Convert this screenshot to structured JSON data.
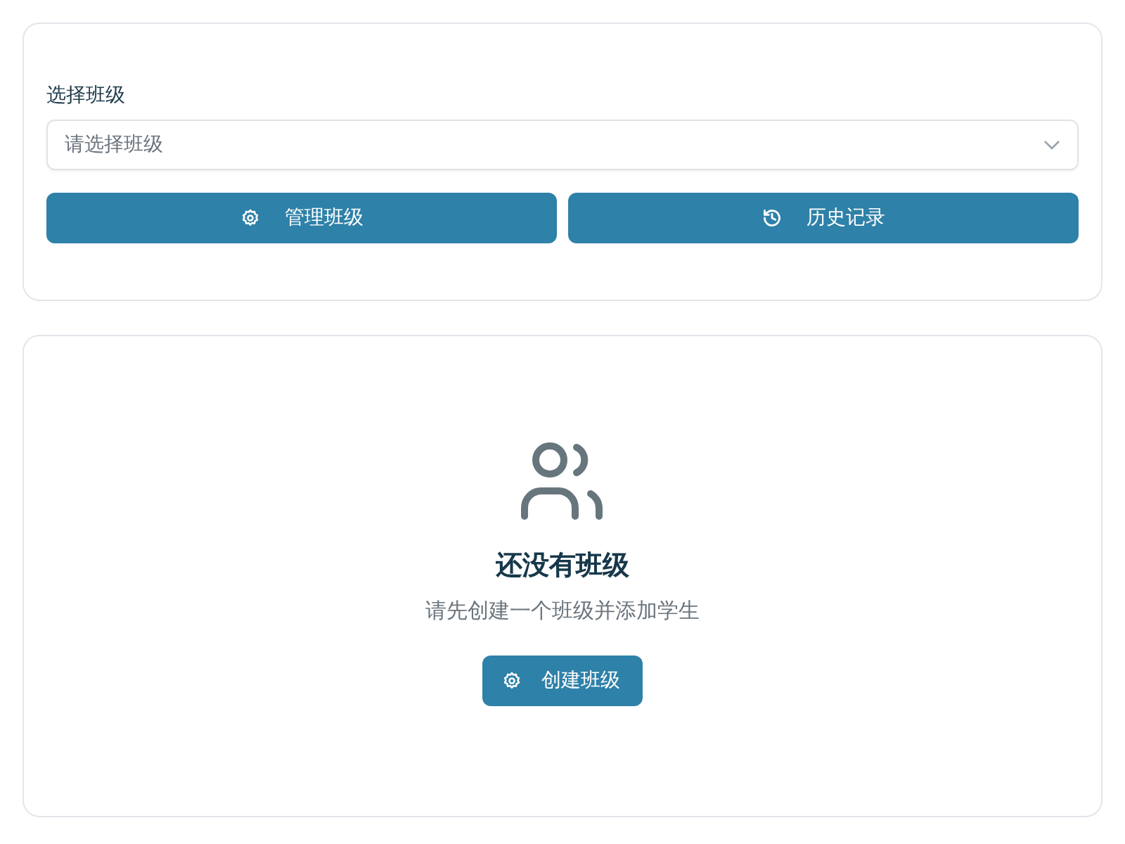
{
  "class_picker": {
    "label": "选择班级",
    "select": {
      "placeholder": "请选择班级"
    },
    "buttons": [
      {
        "label": "管理班级",
        "kind": "manage"
      },
      {
        "label": "历史记录",
        "kind": "history"
      }
    ]
  },
  "empty_state": {
    "title": "还没有班级",
    "message": "请先创建一个班级并添加学生",
    "button": {
      "label": "创建班级",
      "kind": "create"
    }
  }
}
